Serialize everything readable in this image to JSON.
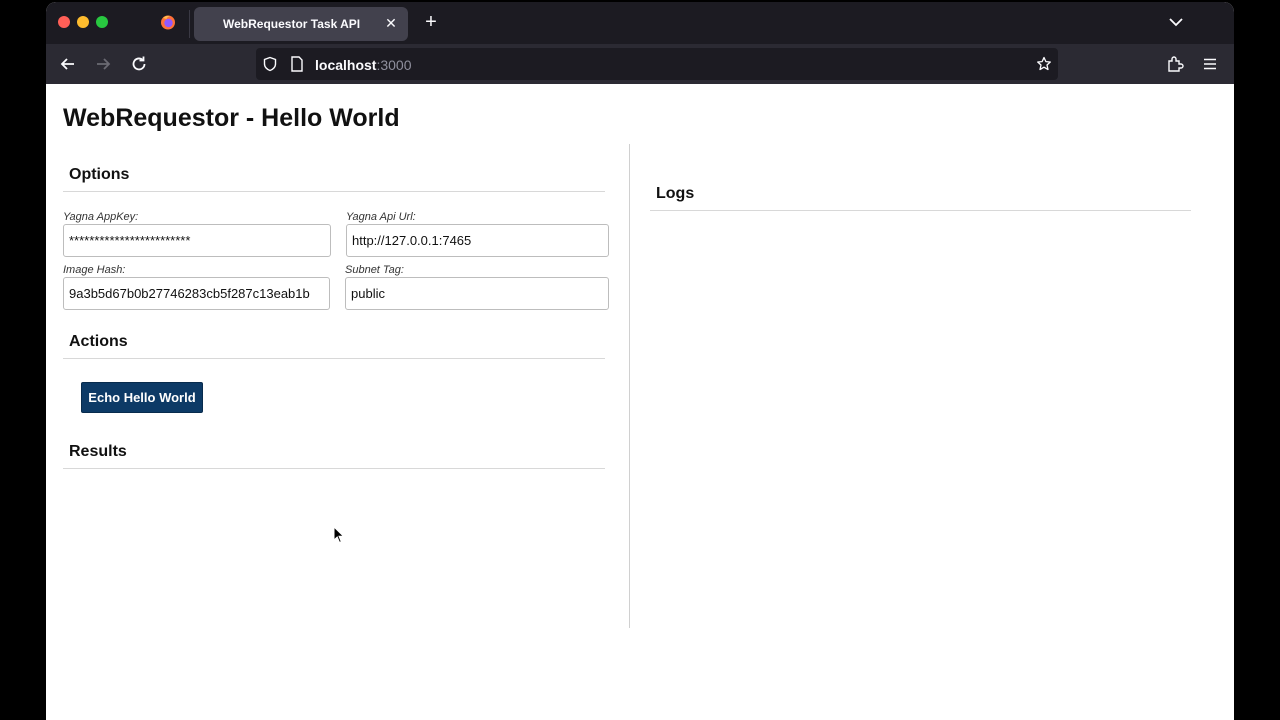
{
  "browser": {
    "tab_title": "WebRequestor Task API",
    "tab_close": "✕",
    "new_tab": "+",
    "url_host": "localhost",
    "url_port": ":3000"
  },
  "page": {
    "title": "WebRequestor - Hello World"
  },
  "options": {
    "heading": "Options",
    "appkey_label": "Yagna AppKey:",
    "appkey_value": "************************",
    "apiurl_label": "Yagna Api Url:",
    "apiurl_value": "http://127.0.0.1:7465",
    "imagehash_label": "Image Hash:",
    "imagehash_value": "9a3b5d67b0b27746283cb5f287c13eab1b",
    "subnet_label": "Subnet Tag:",
    "subnet_value": "public"
  },
  "actions": {
    "heading": "Actions",
    "echo_button": "Echo Hello World"
  },
  "results": {
    "heading": "Results"
  },
  "logs": {
    "heading": "Logs"
  }
}
